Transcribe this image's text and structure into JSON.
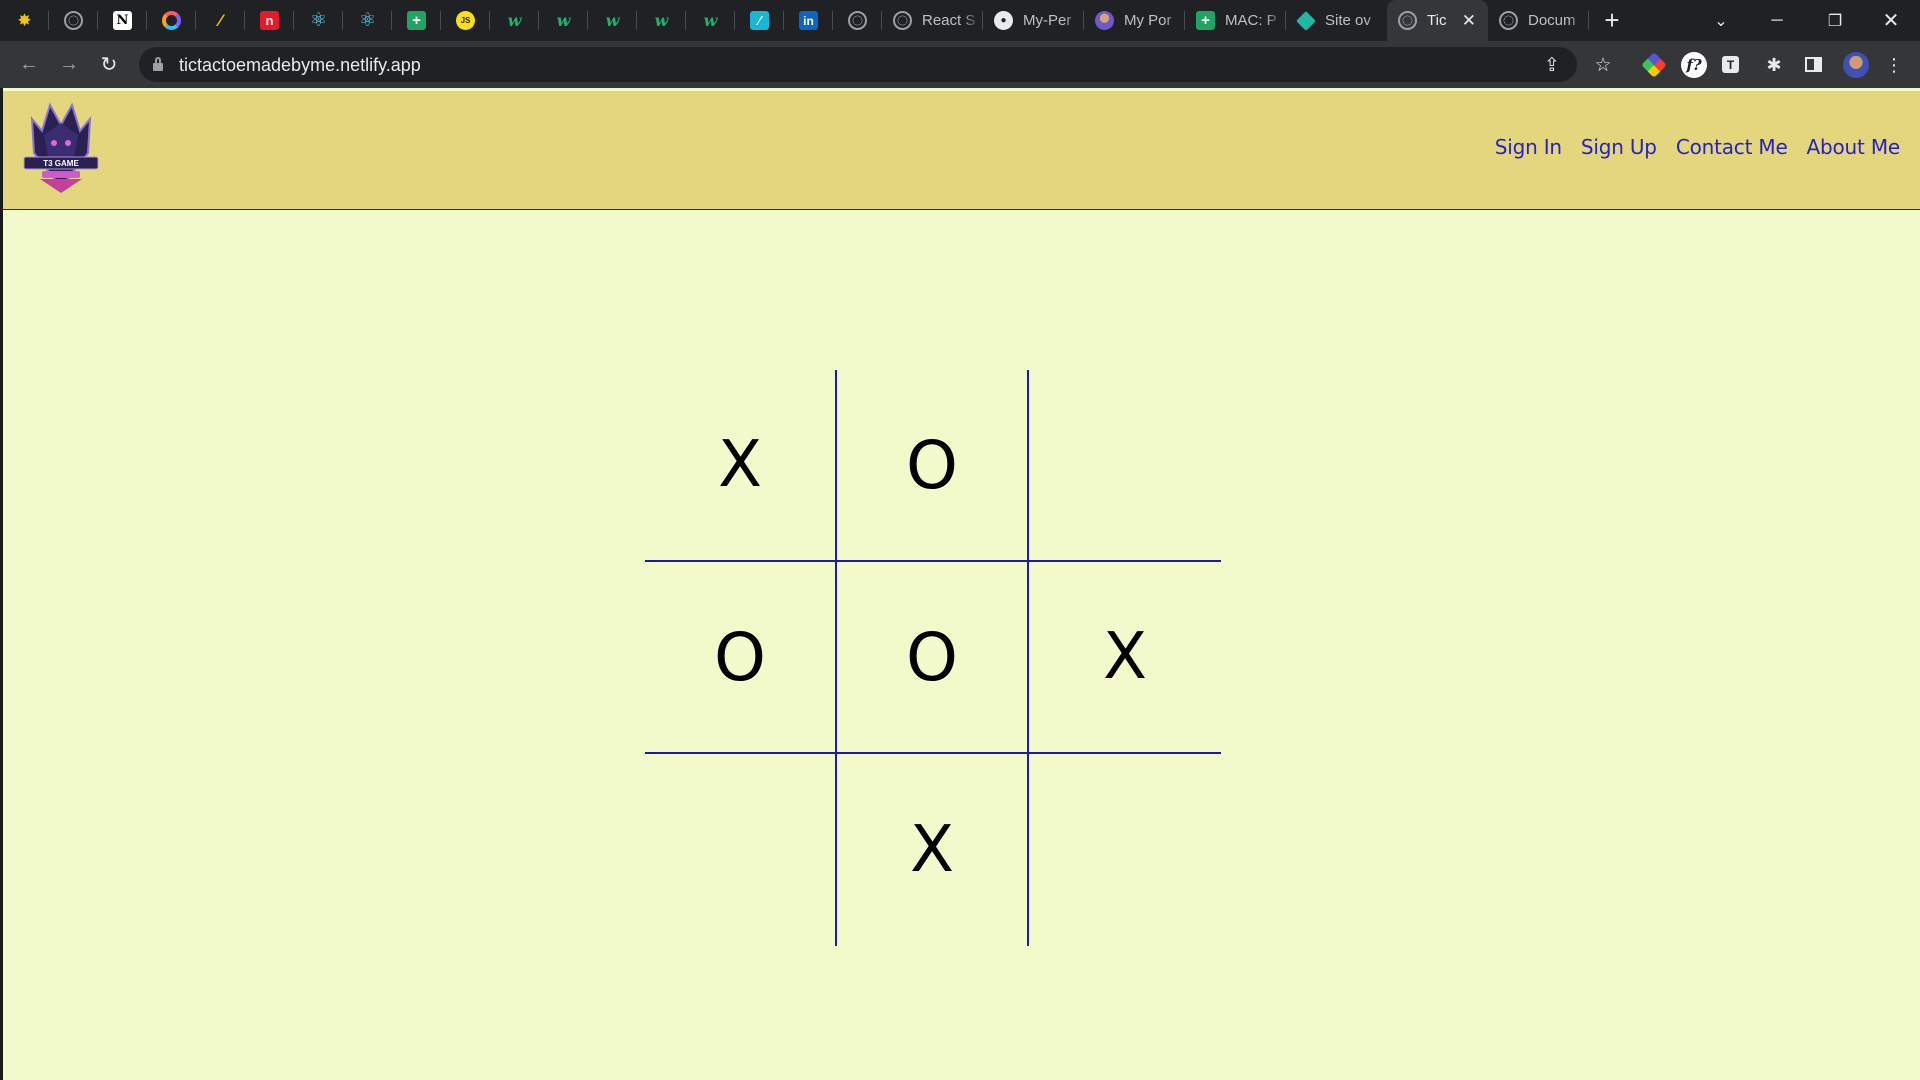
{
  "browser": {
    "tabs": [
      {
        "icon": "app-logo-icon",
        "glyph": "✸",
        "cls": "fav-dash",
        "title": ""
      },
      {
        "icon": "globe-icon",
        "glyph": "",
        "cls": "fav-globe",
        "title": ""
      },
      {
        "icon": "notion-icon",
        "glyph": "N",
        "cls": "fav-notion",
        "title": ""
      },
      {
        "icon": "swirl-icon",
        "glyph": "",
        "cls": "fav-swirl",
        "title": ""
      },
      {
        "icon": "pencil-icon",
        "glyph": "⁄",
        "cls": "fav-dash",
        "title": ""
      },
      {
        "icon": "red-n-icon",
        "glyph": "n",
        "cls": "fav-red",
        "title": ""
      },
      {
        "icon": "react-icon",
        "glyph": "⚛",
        "cls": "fav-react",
        "title": ""
      },
      {
        "icon": "react-icon",
        "glyph": "⚛",
        "cls": "fav-react",
        "title": ""
      },
      {
        "icon": "google-sheets-icon",
        "glyph": "+",
        "cls": "fav-sheets",
        "title": ""
      },
      {
        "icon": "js-icon",
        "glyph": "JS",
        "cls": "fav-js",
        "title": ""
      },
      {
        "icon": "w-icon",
        "glyph": "w",
        "cls": "fav-w",
        "title": ""
      },
      {
        "icon": "w-icon",
        "glyph": "w",
        "cls": "fav-w",
        "title": ""
      },
      {
        "icon": "w-icon",
        "glyph": "w",
        "cls": "fav-w",
        "title": ""
      },
      {
        "icon": "w-icon",
        "glyph": "w",
        "cls": "fav-w",
        "title": ""
      },
      {
        "icon": "w-icon",
        "glyph": "w",
        "cls": "fav-w",
        "title": ""
      },
      {
        "icon": "chart-icon",
        "glyph": "⁄",
        "cls": "fav-chart",
        "title": ""
      },
      {
        "icon": "linkedin-icon",
        "glyph": "in",
        "cls": "fav-linkedin",
        "title": ""
      },
      {
        "icon": "globe-icon",
        "glyph": "",
        "cls": "fav-globe",
        "title": ""
      },
      {
        "icon": "globe-icon",
        "glyph": "",
        "cls": "fav-globe",
        "title": "React S"
      },
      {
        "icon": "github-icon",
        "glyph": "●",
        "cls": "fav-github",
        "title": "My-Per"
      },
      {
        "icon": "avatar-icon",
        "glyph": "",
        "cls": "fav-avatar",
        "title": "My Por"
      },
      {
        "icon": "google-sheets-icon",
        "glyph": "+",
        "cls": "fav-sheets",
        "title": "MAC: P"
      },
      {
        "icon": "netlify-icon",
        "glyph": "",
        "cls": "fav-diamond",
        "title": "Site ov"
      },
      {
        "icon": "globe-icon",
        "glyph": "",
        "cls": "fav-globe",
        "title": "Tic",
        "active": true
      },
      {
        "icon": "globe-icon",
        "glyph": "",
        "cls": "fav-globe",
        "title": "Docum"
      }
    ],
    "url": "tictactoemadebyme.netlify.app"
  },
  "site": {
    "logo_text": "T3 GAME",
    "nav": [
      "Sign In",
      "Sign Up",
      "Contact Me",
      "About Me"
    ]
  },
  "game": {
    "cells": [
      "X",
      "O",
      "",
      "O",
      "O",
      "X",
      "",
      "X",
      ""
    ]
  }
}
